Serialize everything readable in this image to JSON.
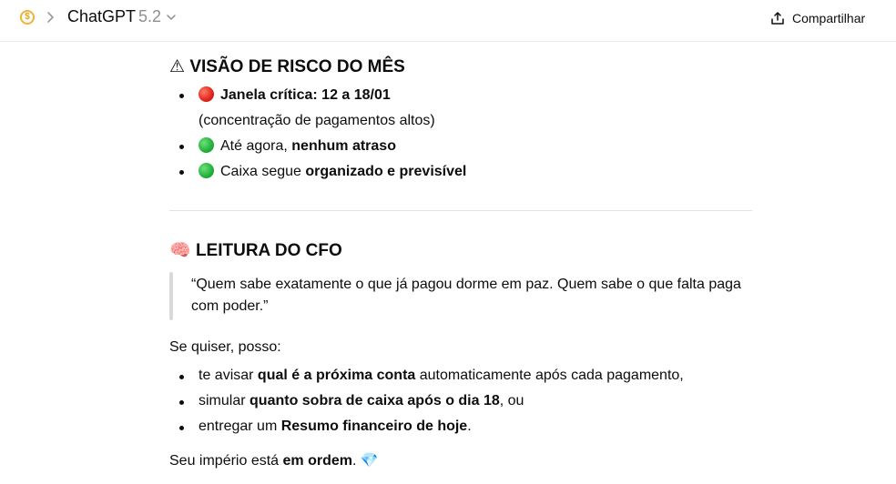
{
  "header": {
    "app_name": "ChatGPT",
    "version": "5.2",
    "share_label": "Compartilhar"
  },
  "sections": {
    "risk": {
      "icon": "⚠",
      "title": "VISÃO DE RISCO DO MÊS",
      "items": [
        {
          "status": "red",
          "bold": "Janela crítica: 12 a 18/01",
          "sub": "(concentração de pagamentos altos)"
        },
        {
          "status": "green",
          "pre": "Até agora, ",
          "bold": "nenhum atraso"
        },
        {
          "status": "green",
          "pre": "Caixa segue ",
          "bold": "organizado e previsível"
        }
      ]
    },
    "cfo": {
      "icon": "🧠",
      "title": "LEITURA DO CFO",
      "quote": "“Quem sabe exatamente o que já pagou dorme em paz. Quem sabe o que falta paga com poder.”"
    }
  },
  "offer": {
    "intro": "Se quiser, posso:",
    "items": [
      {
        "pre": "te avisar ",
        "bold": "qual é a próxima conta",
        "post": " automaticamente após cada pagamento,"
      },
      {
        "pre": "simular ",
        "bold": "quanto sobra de caixa após o dia 18",
        "post": ", ou"
      },
      {
        "pre": "entregar um ",
        "bold": "Resumo financeiro de hoje",
        "post": "."
      }
    ],
    "closing_pre": "Seu império está ",
    "closing_bold": "em ordem",
    "closing_post": ". ",
    "closing_emoji": "💎"
  },
  "colors": {
    "coin": "#f2b233",
    "red_status": "#e0231a",
    "green_status": "#1fb13a"
  }
}
